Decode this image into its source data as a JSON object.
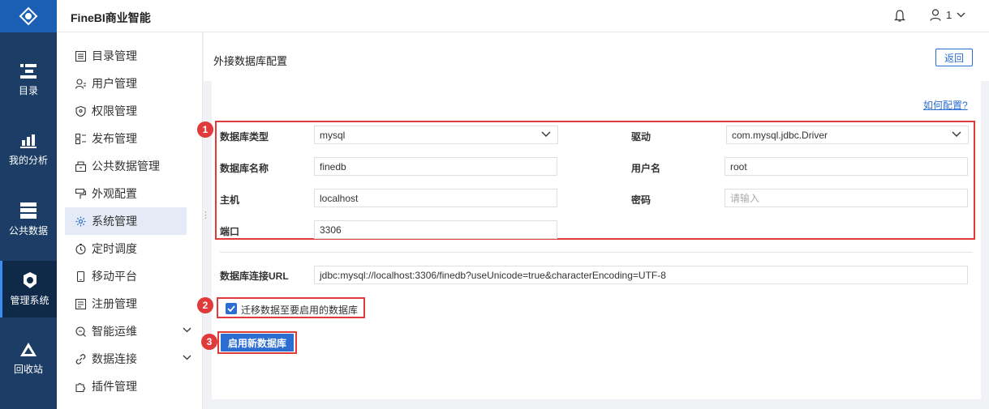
{
  "app": {
    "brand": "FineBI商业智能"
  },
  "header": {
    "user_name": "1"
  },
  "rail": {
    "items": [
      {
        "label": "目录",
        "icon": "catalog-icon"
      },
      {
        "label": "我的分析",
        "icon": "analysis-icon"
      },
      {
        "label": "公共数据",
        "icon": "public-data-icon"
      },
      {
        "label": "管理系统",
        "icon": "management-icon",
        "active": true
      },
      {
        "label": "回收站",
        "icon": "recycle-icon"
      }
    ]
  },
  "menu": {
    "items": [
      {
        "label": "目录管理",
        "icon": "catalog-manage-icon"
      },
      {
        "label": "用户管理",
        "icon": "user-manage-icon"
      },
      {
        "label": "权限管理",
        "icon": "permission-icon"
      },
      {
        "label": "发布管理",
        "icon": "publish-icon"
      },
      {
        "label": "公共数据管理",
        "icon": "public-data-manage-icon"
      },
      {
        "label": "外观配置",
        "icon": "appearance-icon"
      },
      {
        "label": "系统管理",
        "icon": "gear-icon",
        "active": true
      },
      {
        "label": "定时调度",
        "icon": "timer-icon"
      },
      {
        "label": "移动平台",
        "icon": "mobile-icon"
      },
      {
        "label": "注册管理",
        "icon": "register-icon"
      },
      {
        "label": "智能运维",
        "icon": "ops-icon",
        "expandable": true
      },
      {
        "label": "数据连接",
        "icon": "link-icon",
        "expandable": true
      },
      {
        "label": "插件管理",
        "icon": "plugin-icon"
      }
    ]
  },
  "page": {
    "title": "外接数据库配置",
    "back_label": "返回",
    "help_link": "如何配置?"
  },
  "form": {
    "db_type_label": "数据库类型",
    "db_type_value": "mysql",
    "driver_label": "驱动",
    "driver_value": "com.mysql.jdbc.Driver",
    "db_name_label": "数据库名称",
    "db_name_value": "finedb",
    "username_label": "用户名",
    "username_value": "root",
    "host_label": "主机",
    "host_value": "localhost",
    "password_label": "密码",
    "password_placeholder": "请输入",
    "port_label": "端口",
    "port_value": "3306",
    "url_label": "数据库连接URL",
    "url_value": "jdbc:mysql://localhost:3306/finedb?useUnicode=true&characterEncoding=UTF-8",
    "migrate_label": "迁移数据至要启用的数据库",
    "migrate_checked": true,
    "enable_label": "启用新数据库"
  },
  "annotations": {
    "badge1": "1",
    "badge2": "2",
    "badge3": "3"
  },
  "colors": {
    "accent": "#2c6dd2",
    "rail_bg": "#1c3e66",
    "highlight_red": "#e03a3a"
  }
}
